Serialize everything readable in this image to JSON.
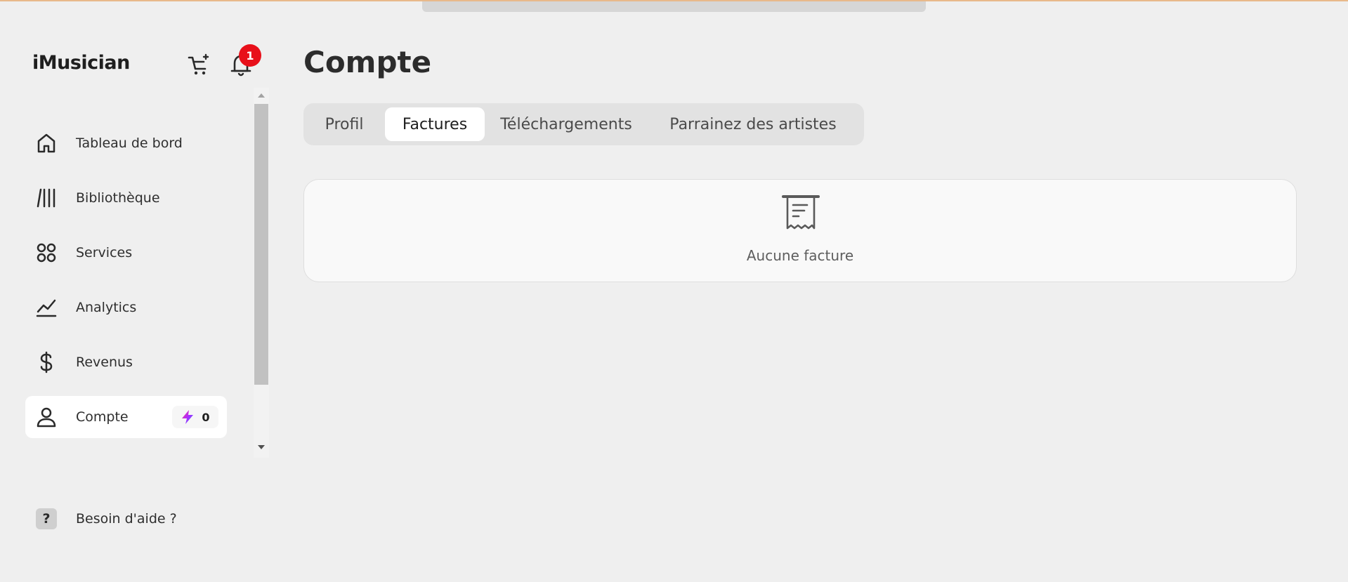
{
  "app": {
    "brand": "iMusician"
  },
  "header": {
    "notifications_count": "1"
  },
  "sidebar": {
    "items": [
      {
        "label": "Tableau de bord",
        "icon": "home-icon"
      },
      {
        "label": "Bibliothèque",
        "icon": "library-icon"
      },
      {
        "label": "Services",
        "icon": "services-icon"
      },
      {
        "label": "Analytics",
        "icon": "analytics-icon"
      },
      {
        "label": "Revenus",
        "icon": "dollar-icon"
      },
      {
        "label": "Compte",
        "icon": "user-icon",
        "active": true,
        "credits": "0"
      }
    ],
    "help_label": "Besoin d'aide ?",
    "help_icon": "question-icon"
  },
  "main": {
    "title": "Compte",
    "tabs": [
      {
        "label": "Profil"
      },
      {
        "label": "Factures",
        "active": true
      },
      {
        "label": "Téléchargements"
      },
      {
        "label": "Parrainez des artistes"
      }
    ],
    "empty_state": {
      "icon": "receipt-icon",
      "text": "Aucune facture"
    }
  },
  "colors": {
    "background": "#efefef",
    "badge": "#e8101a",
    "active_bg": "#ffffff",
    "tabs_bg": "#e2e2e2"
  }
}
